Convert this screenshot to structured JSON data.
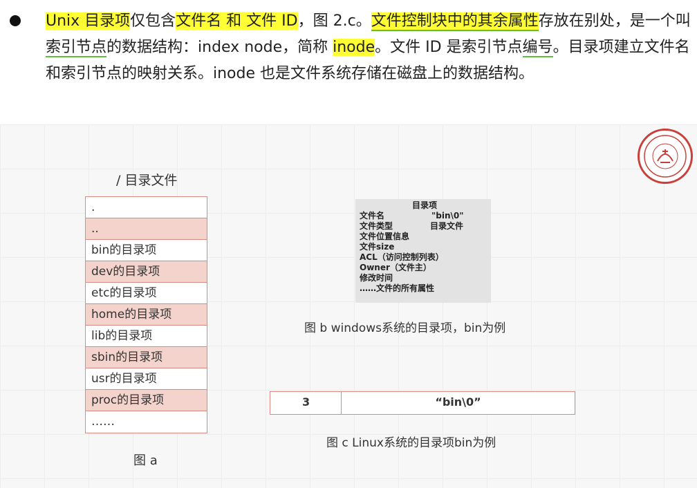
{
  "bullet": {
    "seg1": "Unix 目录项",
    "seg2": "仅包含",
    "seg3": "文件名  和  文件 ID",
    "seg4": "，图 2.c。",
    "seg5": "文件控制块中的其余属性",
    "seg6": "存放在别处，是一个叫",
    "seg7": "索引节点",
    "seg8": "的数据结构：index node，简称 ",
    "seg9": "inode",
    "seg10": "。文件 ID 是索引节点",
    "seg11": "编号",
    "seg12": "。目录项建立文件名和索引节点的映射关系。inode 也是文件系统存储在磁盘上的数据结构。"
  },
  "figure_a": {
    "title": "/ 目录文件",
    "rows": [
      ".",
      "..",
      "bin的目录项",
      "dev的目录项",
      "etc的目录项",
      "home的目录项",
      "lib的目录项",
      "sbin的目录项",
      "usr的目录项",
      "proc的目录项",
      "……"
    ],
    "caption": "图 a"
  },
  "figure_b": {
    "box_title": "目录项",
    "lines": [
      {
        "label": "文件名",
        "value": "\"bin\\0\""
      },
      {
        "label": "文件类型",
        "value": "目录文件"
      },
      {
        "label": "文件位置信息",
        "value": ""
      },
      {
        "label": "文件size",
        "value": ""
      },
      {
        "label": "ACL（访问控制列表）",
        "value": ""
      },
      {
        "label": "Owner（文件主）",
        "value": ""
      },
      {
        "label": "修改时间",
        "value": ""
      },
      {
        "label": "……文件的所有属性",
        "value": ""
      }
    ],
    "caption": "图 b  windows系统的目录项，bin为例"
  },
  "figure_c": {
    "id": "3",
    "name": "“bin\\0”",
    "caption": "图 c  Linux系统的目录项bin为例"
  },
  "colors": {
    "highlight": "#ffff33",
    "table_border": "#d78a80",
    "row_alt": "#f3d3cc",
    "logo_red": "#c8403a"
  }
}
